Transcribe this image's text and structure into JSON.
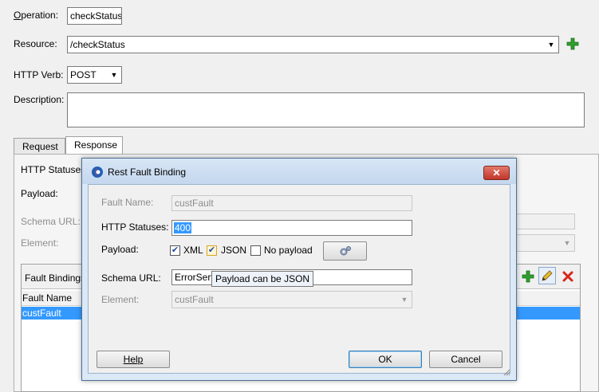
{
  "form": {
    "operation_label": "Operation:",
    "operation_value": "checkStatus",
    "resource_label": "Resource:",
    "resource_value": "/checkStatus",
    "http_verb_label": "HTTP Verb:",
    "http_verb_value": "POST",
    "description_label": "Description:",
    "description_value": ""
  },
  "tabs": [
    {
      "label": "Request"
    },
    {
      "label": "Response"
    }
  ],
  "response_panel": {
    "http_statuses_label": "HTTP Statuses",
    "payload_label": "Payload:",
    "schema_url_label": "Schema URL:",
    "element_label": "Element:"
  },
  "fault_bindings": {
    "title": "Fault Bindings",
    "column_header": "Fault Name",
    "rows": [
      {
        "name": "custFault"
      }
    ]
  },
  "dialog": {
    "title": "Rest Fault Binding",
    "close_symbol": "✕",
    "fault_name_label": "Fault Name:",
    "fault_name_value": "custFault",
    "http_statuses_label": "HTTP Statuses:",
    "http_statuses_value": "400",
    "payload_label": "Payload:",
    "payload_xml_label": "XML",
    "payload_json_label": "JSON",
    "payload_none_label": "No payload",
    "schema_url_label": "Schema URL:",
    "schema_url_value": "ErrorServ",
    "element_label": "Element:",
    "element_value": "custFault",
    "help_button": "Help",
    "ok_button": "OK",
    "cancel_button": "Cancel"
  },
  "tooltip": {
    "text": "Payload can be JSON"
  },
  "colors": {
    "selection": "#3399ff",
    "add_green": "#2e9e2e",
    "delete_red": "#d8261d",
    "dialog_close": "#c9483a"
  }
}
